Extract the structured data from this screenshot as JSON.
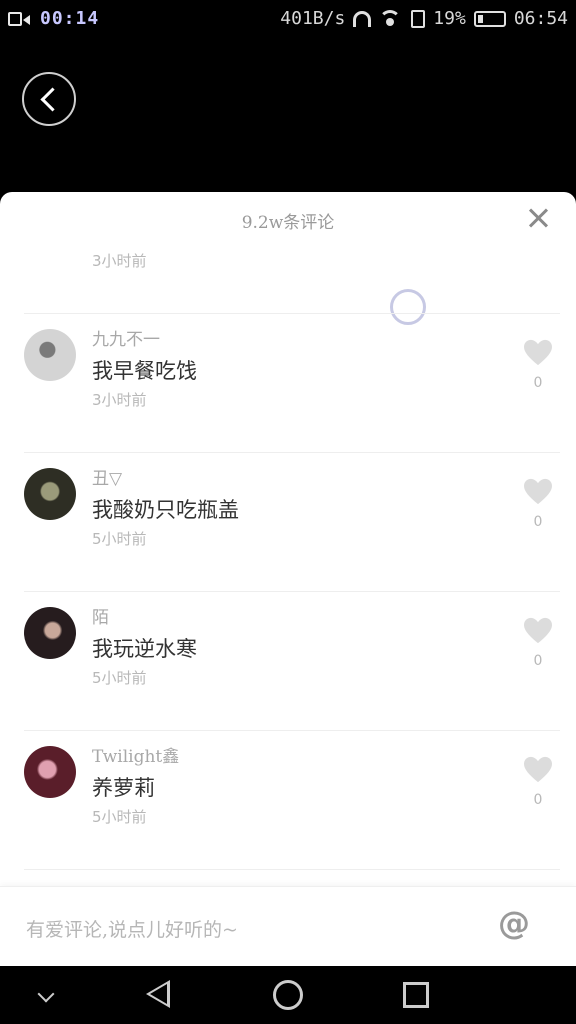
{
  "status_bar": {
    "recording_time": "00:14",
    "net_speed": "401B/s",
    "battery_percent": "19%",
    "clock": "06:54"
  },
  "panel": {
    "title": "9.2w条评论",
    "partial_time": "3小时前"
  },
  "comments": [
    {
      "username": "九九不一",
      "text": "我早餐吃饯",
      "time": "3小时前",
      "likes": "0",
      "avatar_color": "#c9c9c9"
    },
    {
      "username": "丑▽",
      "text": "我酸奶只吃瓶盖",
      "time": "5小时前",
      "likes": "0",
      "avatar_color": "#3a3a30"
    },
    {
      "username": "陌",
      "text": "我玩逆水寒",
      "time": "5小时前",
      "likes": "0",
      "avatar_color": "#2e2226"
    },
    {
      "username": "Twilight鑫",
      "text": "养萝莉",
      "time": "5小时前",
      "likes": "0",
      "avatar_color": "#8a3a4a"
    }
  ],
  "input": {
    "placeholder": "有爱评论,说点儿好听的~",
    "at_symbol": "@"
  },
  "colors": {
    "heart_gray": "#dcdcdc",
    "panel_bg": "#ffffff"
  }
}
